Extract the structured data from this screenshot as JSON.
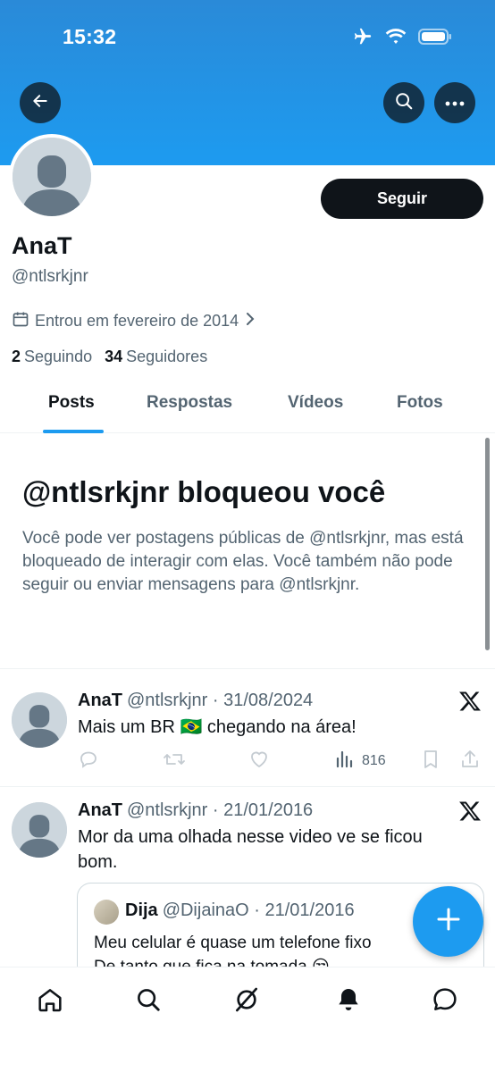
{
  "status_bar": {
    "time": "15:32",
    "icons": [
      "airplane-icon",
      "wifi-icon",
      "battery-icon"
    ]
  },
  "header": {
    "back_icon": "arrow-left-icon",
    "search_icon": "search-icon",
    "more_icon": "more-horizontal-icon",
    "banner_color": "#1d9bf0"
  },
  "profile": {
    "display_name": "AnaT",
    "handle": "@ntlsrkjnr",
    "follow_label": "Seguir",
    "joined": "Entrou em fevereiro de 2014",
    "following_count": "2",
    "following_label": "Seguindo",
    "followers_count": "34",
    "followers_label": "Seguidores"
  },
  "tabs": [
    {
      "label": "Posts",
      "active": true
    },
    {
      "label": "Respostas",
      "active": false
    },
    {
      "label": "Vídeos",
      "active": false
    },
    {
      "label": "Fotos",
      "active": false
    }
  ],
  "blocked": {
    "title": "@ntlsrkjnr bloqueou você",
    "text": "Você pode ver postagens públicas de @ntlsrkjnr, mas está bloqueado de interagir com elas. Você também não pode seguir ou enviar mensagens para @ntlsrkjnr."
  },
  "posts": [
    {
      "name": "AnaT",
      "meta": "@ntlsrkjnr · 31/08/2024",
      "text": "Mais um BR 🇧🇷 chegando na área!",
      "views": "816"
    },
    {
      "name": "AnaT",
      "meta": "@ntlsrkjnr · 21/01/2016",
      "text": "Mor da uma olhada nesse video ve se ficou bom.",
      "quote": {
        "name": "Dija",
        "meta": "@DijainaO · 21/01/2016",
        "text_line1": "Meu celular é quase um telefone fixo",
        "text_line2": "De tanto que fica na tomada 😒"
      }
    }
  ],
  "accent_color": "#1d9bf0",
  "bottom_nav": [
    "home-icon",
    "explore-icon",
    "grok-icon",
    "notifications-icon",
    "messages-icon"
  ]
}
